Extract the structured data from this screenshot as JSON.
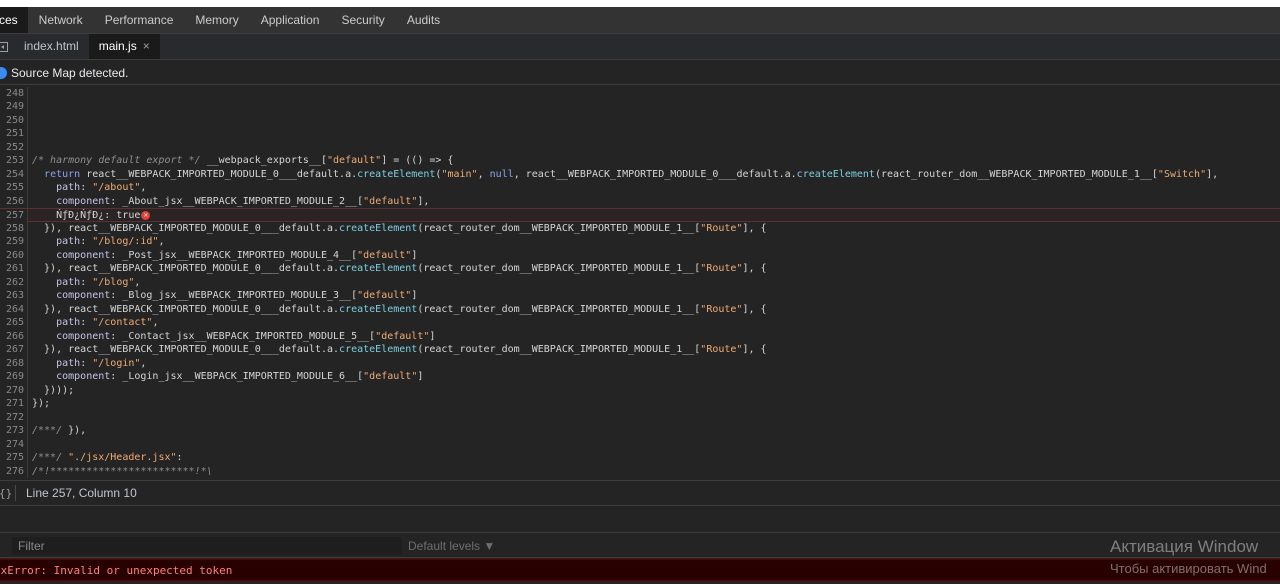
{
  "main_tabs": [
    "rces",
    "Network",
    "Performance",
    "Memory",
    "Application",
    "Security",
    "Audits"
  ],
  "file_tabs": [
    {
      "label": "index.html"
    },
    {
      "label": "main.js",
      "close": "×"
    }
  ],
  "infobar": {
    "text": "Source Map detected."
  },
  "code_lines": [
    {
      "num": "248",
      "text": ""
    },
    {
      "num": "249",
      "text": ""
    },
    {
      "num": "250",
      "text": ""
    },
    {
      "num": "251",
      "text": ""
    },
    {
      "num": "252",
      "text": ""
    },
    {
      "num": "253",
      "text": "/* harmony default export */ __webpack_exports__[\"default\"] = (() => {"
    },
    {
      "num": "254",
      "text": "  return react__WEBPACK_IMPORTED_MODULE_0___default.a.createElement(\"main\", null, react__WEBPACK_IMPORTED_MODULE_0___default.a.createElement(react_router_dom__WEBPACK_IMPORTED_MODULE_1__[\"Switch\"],"
    },
    {
      "num": "255",
      "text": "    path: \"/about\","
    },
    {
      "num": "256",
      "text": "    component: _About_jsx__WEBPACK_IMPORTED_MODULE_2__[\"default\"],"
    },
    {
      "num": "257",
      "text": "    ŃƒÐ¿ŃƒÐ¿: true"
    },
    {
      "num": "258",
      "text": "  }), react__WEBPACK_IMPORTED_MODULE_0___default.a.createElement(react_router_dom__WEBPACK_IMPORTED_MODULE_1__[\"Route\"], {"
    },
    {
      "num": "259",
      "text": "    path: \"/blog/:id\","
    },
    {
      "num": "260",
      "text": "    component: _Post_jsx__WEBPACK_IMPORTED_MODULE_4__[\"default\"]"
    },
    {
      "num": "261",
      "text": "  }), react__WEBPACK_IMPORTED_MODULE_0___default.a.createElement(react_router_dom__WEBPACK_IMPORTED_MODULE_1__[\"Route\"], {"
    },
    {
      "num": "262",
      "text": "    path: \"/blog\","
    },
    {
      "num": "263",
      "text": "    component: _Blog_jsx__WEBPACK_IMPORTED_MODULE_3__[\"default\"]"
    },
    {
      "num": "264",
      "text": "  }), react__WEBPACK_IMPORTED_MODULE_0___default.a.createElement(react_router_dom__WEBPACK_IMPORTED_MODULE_1__[\"Route\"], {"
    },
    {
      "num": "265",
      "text": "    path: \"/contact\","
    },
    {
      "num": "266",
      "text": "    component: _Contact_jsx__WEBPACK_IMPORTED_MODULE_5__[\"default\"]"
    },
    {
      "num": "267",
      "text": "  }), react__WEBPACK_IMPORTED_MODULE_0___default.a.createElement(react_router_dom__WEBPACK_IMPORTED_MODULE_1__[\"Route\"], {"
    },
    {
      "num": "268",
      "text": "    path: \"/login\","
    },
    {
      "num": "269",
      "text": "    component: _Login_jsx__WEBPACK_IMPORTED_MODULE_6__[\"default\"]"
    },
    {
      "num": "270",
      "text": "  })));"
    },
    {
      "num": "271",
      "text": "});"
    },
    {
      "num": "272",
      "text": ""
    },
    {
      "num": "273",
      "text": "/***/ }),"
    },
    {
      "num": "274",
      "text": ""
    },
    {
      "num": "275",
      "text": "/***/ \"./jsx/Header.jsx\":"
    },
    {
      "num": "276",
      "text": "/*!************************!*\\"
    }
  ],
  "error_line": "257",
  "status": {
    "brace": "{}",
    "position": "Line 257, Column 10"
  },
  "console": {
    "filter_placeholder": "Filter",
    "levels_label": "Default levels ▼",
    "error_message": "axError: Invalid or unexpected token"
  },
  "watermark": {
    "title": "Активация Window",
    "subtitle": "Чтобы активировать Wind"
  }
}
